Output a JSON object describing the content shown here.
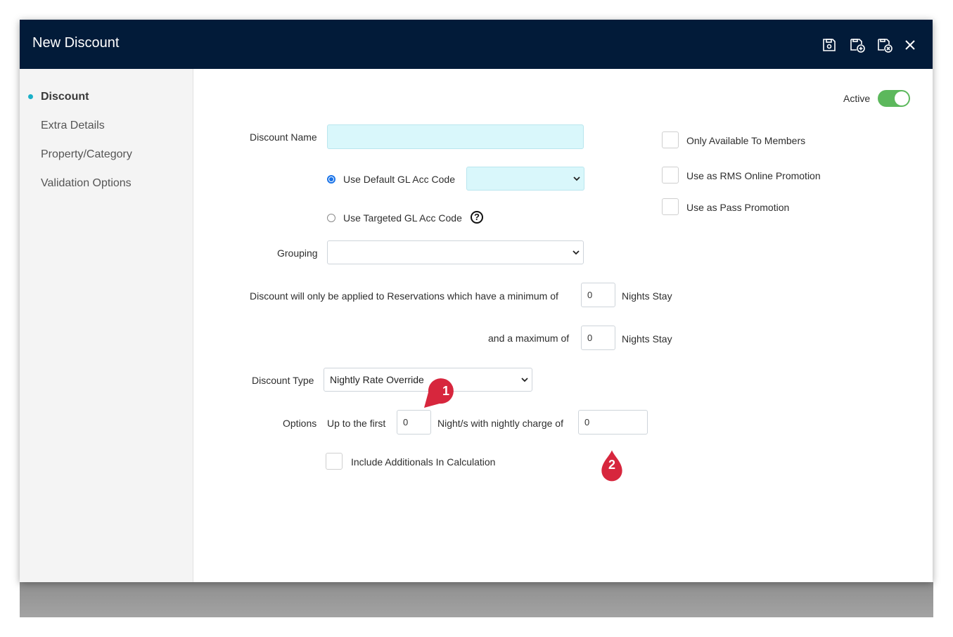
{
  "window": {
    "title": "New Discount",
    "accent_color": "#021b39",
    "icons": [
      "save-icon",
      "save-new-icon",
      "save-close-icon",
      "close-icon"
    ]
  },
  "sidebar": {
    "items": [
      {
        "label": "Discount",
        "active": true
      },
      {
        "label": "Extra Details",
        "active": false
      },
      {
        "label": "Property/Category",
        "active": false
      },
      {
        "label": "Validation Options",
        "active": false
      }
    ]
  },
  "form": {
    "active_label": "Active",
    "active_on": true,
    "discount_name_label": "Discount Name",
    "discount_name_value": "",
    "use_default_gl_label": "Use Default GL Acc Code",
    "use_default_gl_selected": true,
    "default_gl_value": "",
    "use_targeted_gl_label": "Use Targeted GL Acc Code",
    "help_glyph": "?",
    "grouping_label": "Grouping",
    "grouping_value": "",
    "min_nights_text": "Discount will only be applied to Reservations which have a minimum of",
    "min_nights_value": "0",
    "nights_stay_label": "Nights Stay",
    "max_nights_text": "and a maximum of",
    "max_nights_value": "0",
    "discount_type_label": "Discount Type",
    "discount_type_value": "Nightly Rate Override",
    "options_label": "Options",
    "up_to_first_label": "Up to the first",
    "up_to_first_value": "0",
    "nightly_charge_label": "Night/s with nightly charge of",
    "nightly_charge_value": "0",
    "include_additionals_label": "Include Additionals In Calculation",
    "only_members_label": "Only Available To Members",
    "rms_online_label": "Use as RMS Online Promotion",
    "pass_promotion_label": "Use as Pass Promotion"
  },
  "annotations": {
    "marker_1": "1",
    "marker_2": "2",
    "marker_color": "#d7263d"
  }
}
